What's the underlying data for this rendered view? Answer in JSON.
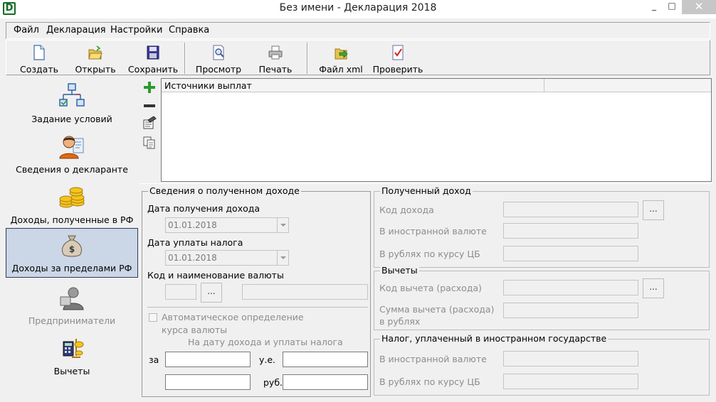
{
  "window": {
    "title": "Без имени - Декларация 2018",
    "app_icon_letter": "D",
    "min_glyph": "_",
    "max_glyph": "□",
    "close_glyph": "✕"
  },
  "menu": [
    "Файл",
    "Декларация",
    "Настройки",
    "Справка"
  ],
  "toolbar": {
    "create": "Создать",
    "open": "Открыть",
    "save": "Сохранить",
    "preview": "Просмотр",
    "print": "Печать",
    "xml": "Файл xml",
    "check": "Проверить"
  },
  "nav": {
    "conditions": "Задание условий",
    "declarant": "Сведения о декларанте",
    "income_rf": "Доходы, полученные в РФ",
    "income_abroad": "Доходы за пределами РФ",
    "entrepreneurs": "Предприниматели",
    "deductions": "Вычеты"
  },
  "sources": {
    "column": "Источники выплат"
  },
  "income_info": {
    "title": "Сведения о полученном доходе",
    "date_received_label": "Дата получения дохода",
    "date_received": "01.01.2018",
    "date_tax_label": "Дата уплаты налога",
    "date_tax": "01.01.2018",
    "currency_label": "Код и наименование валюты",
    "browse": "...",
    "auto_rate_1": "Автоматическое определение",
    "auto_rate_2": "курса валюты",
    "on_date": "На дату дохода и уплаты налога",
    "per": "за",
    "units": "у.е.",
    "rub": "руб."
  },
  "received_income": {
    "title": "Полученный доход",
    "code_label": "Код дохода",
    "browse": "...",
    "foreign_label": "В иностранной валюте",
    "rub_label": "В рублях по курсу ЦБ"
  },
  "deductions": {
    "title": "Вычеты",
    "code_label": "Код вычета (расхода)",
    "browse": "...",
    "sum_label_1": "Сумма вычета (расхода)",
    "sum_label_2": "в рублях"
  },
  "foreign_tax": {
    "title": "Налог, уплаченный в иностранном государстве",
    "foreign_label": "В иностранной валюте",
    "rub_label": "В рублях по курсу ЦБ"
  },
  "colors": {
    "window_bg": "#f0f0f0",
    "active_nav_bg": "#cbd7e7",
    "active_nav_border": "#2a3c5a"
  }
}
